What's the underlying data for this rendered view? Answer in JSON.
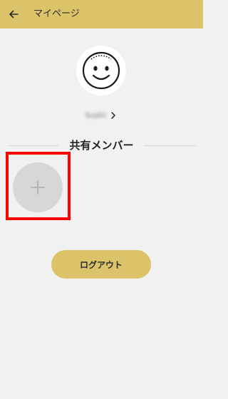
{
  "header": {
    "title": "マイページ",
    "back_icon": "arrow-left-icon",
    "background_color": "#dcc36a"
  },
  "profile": {
    "avatar_icon": "smiley-face-icon",
    "user_name": "Sushi",
    "user_name_blurred": true,
    "chevron_icon": "chevron-right-icon"
  },
  "shared_members": {
    "section_title": "共有メンバー",
    "add_icon": "plus-icon",
    "highlight_color": "#ff0000"
  },
  "actions": {
    "logout_label": "ログアウト",
    "logout_color": "#dcc36a"
  }
}
